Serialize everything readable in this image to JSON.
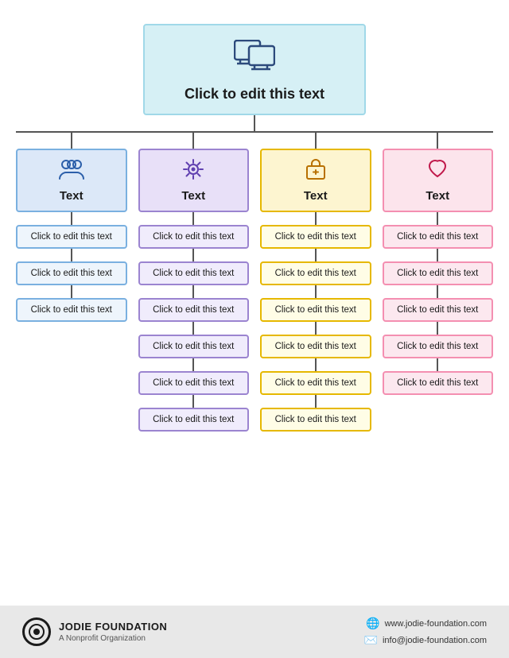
{
  "root": {
    "title": "Click to edit this text",
    "icon": "🖥"
  },
  "columns": [
    {
      "theme": "col-blue",
      "icon": "👥",
      "label": "Text",
      "items": [
        "Click to edit this text",
        "Click to edit this text",
        "Click to edit this text"
      ]
    },
    {
      "theme": "col-purple",
      "icon": "⚙️",
      "label": "Text",
      "items": [
        "Click to edit this text",
        "Click to edit this text",
        "Click to edit this text",
        "Click to edit this text",
        "Click to edit this text",
        "Click to edit this text"
      ]
    },
    {
      "theme": "col-yellow",
      "icon": "💼",
      "label": "Text",
      "items": [
        "Click to edit this text",
        "Click to edit this text",
        "Click to edit this text",
        "Click to edit this text",
        "Click to edit this text",
        "Click to edit this text"
      ]
    },
    {
      "theme": "col-pink",
      "icon": "🤍",
      "label": "Text",
      "items": [
        "Click to edit this text",
        "Click to edit this text",
        "Click to edit this text",
        "Click to edit this text",
        "Click to edit this text"
      ]
    }
  ],
  "footer": {
    "org_name": "JODIE FOUNDATION",
    "org_sub": "A Nonprofit Organization",
    "website": "www.jodie-foundation.com",
    "email": "info@jodie-foundation.com"
  }
}
